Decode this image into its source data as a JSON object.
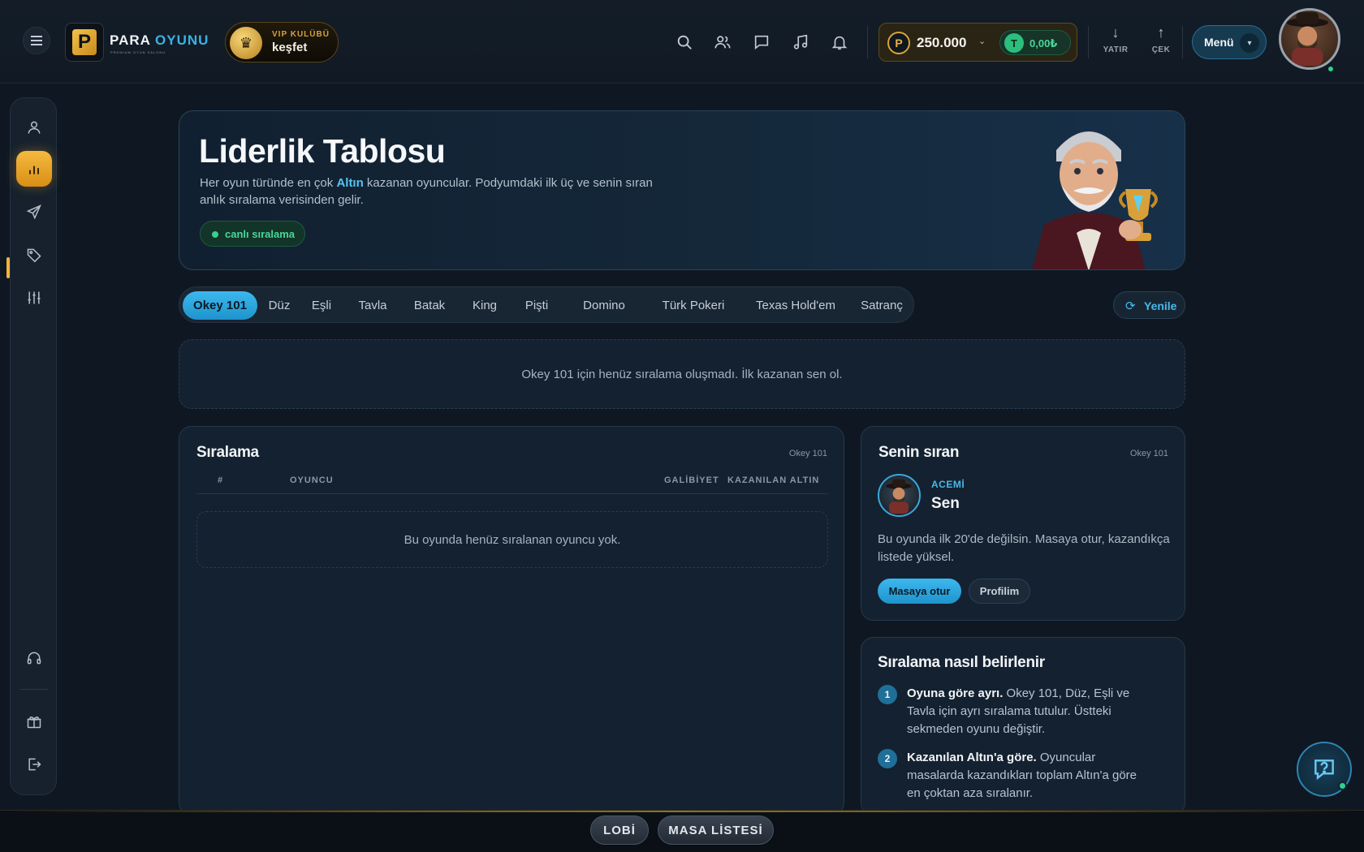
{
  "header": {
    "logo_letter": "P",
    "brand_word1": "PARA",
    "brand_word2": "OYUNU",
    "brand_tagline": "PREMIUM OYUN SALONU",
    "vip_label": "VIP KULÜBÜ",
    "vip_action": "keşfet",
    "icons": [
      "search-icon",
      "friends-icon",
      "chat-icon",
      "music-icon",
      "bell-icon"
    ],
    "balance": "250.000",
    "balance_coin_letter": "P",
    "tl_coin_letter": "T",
    "tl_balance": "0,00₺",
    "deposit_label": "YATIR",
    "withdraw_label": "ÇEK",
    "menu_label": "Menü"
  },
  "sidebar": {
    "items": [
      "profile-icon",
      "leaderboard-icon",
      "send-icon",
      "tag-icon",
      "sliders-icon",
      "headset-icon",
      "gift-icon",
      "logout-icon"
    ],
    "active": "leaderboard-icon"
  },
  "hero": {
    "title": "Liderlik Tablosu",
    "subtitle_pre": "Her oyun türünde en çok ",
    "subtitle_highlight": "Altın",
    "subtitle_post": " kazanan oyuncular. Podyumdaki ilk üç ve senin sıran anlık sıralama verisinden gelir.",
    "live_label": "canlı sıralama"
  },
  "tabs": {
    "items": [
      "Okey 101",
      "Düz",
      "Eşli",
      "Tavla",
      "Batak",
      "King",
      "Pişti",
      "Domino",
      "Türk Pokeri",
      "Texas Hold'em",
      "Satranç"
    ],
    "active": "Okey 101",
    "refresh_label": "Yenile"
  },
  "empty_banner": "Okey 101 için henüz sıralama oluşmadı. İlk kazanan sen ol.",
  "ranking": {
    "title": "Sıralama",
    "game_tag": "Okey 101",
    "columns": [
      "#",
      "OYUNCU",
      "GALİBİYET",
      "KAZANILAN ALTIN"
    ],
    "empty_text": "Bu oyunda henüz sıralanan oyuncu yok."
  },
  "my_rank": {
    "title": "Senin sıran",
    "game_tag": "Okey 101",
    "level": "ACEMİ",
    "name": "Sen",
    "description": "Bu oyunda ilk 20'de değilsin. Masaya otur, kazandıkça listede yüksel.",
    "primary_button": "Masaya otur",
    "secondary_button": "Profilim"
  },
  "how_it_works": {
    "title": "Sıralama nasıl belirlenir",
    "steps": [
      {
        "num": "1",
        "bold": "Oyuna göre ayrı.",
        "text": " Okey 101, Düz, Eşli ve Tavla için ayrı sıralama tutulur. Üstteki sekmeden oyunu değiştir."
      },
      {
        "num": "2",
        "bold": "Kazanılan Altın'a göre.",
        "text": " Oyuncular masalarda kazandıkları toplam Altın'a göre en çoktan aza sıralanır."
      }
    ]
  },
  "bottom_bar": {
    "lobby_label": "LOBİ",
    "tables_label": "MASA LİSTESİ"
  },
  "colors": {
    "accent_blue": "#3cb8ee",
    "accent_gold": "#f5b940",
    "live_green": "#35d28d",
    "background": "#0f1822"
  }
}
